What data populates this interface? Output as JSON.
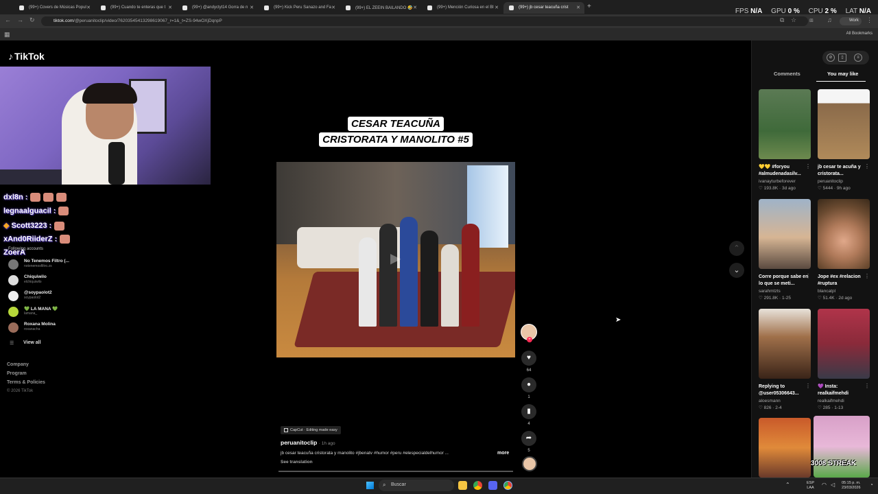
{
  "browser": {
    "tabs": [
      {
        "label": "(99+) Covers de Músicas Popul"
      },
      {
        "label": "(99+) Cuando te enteras que t"
      },
      {
        "label": "(99+) @andyctyt14 Gorra de n"
      },
      {
        "label": "(99+) Kick Peru Sanazo and Fa"
      },
      {
        "label": "(99+) EL ZEEIN BAILANDO 🤣"
      },
      {
        "label": "(99+) Mención Curiosa en el Bl"
      },
      {
        "label": "(99+) jb cesar teacuña crist"
      }
    ],
    "new_tab": "+",
    "url_host": "tiktok.com",
    "url_path": "/@peruanitoclip/video/76203545413298619067_r=1&_t=ZS-94wOXjDqnpP",
    "profile_label": "Work",
    "all_bookmarks": "All Bookmarks"
  },
  "perf_overlay": {
    "fps_label": "FPS",
    "fps_value": "N/A",
    "gpu_label": "GPU",
    "gpu_value": "0 %",
    "cpu_label": "CPU",
    "cpu_value": "2 %",
    "lat_label": "LAT",
    "lat_value": "N/A"
  },
  "tiktok": {
    "logo": "TikTok",
    "chat": [
      {
        "user": "dxl8n :"
      },
      {
        "user": "legnaalguacil :"
      },
      {
        "user": "Scott3223 :"
      },
      {
        "user": "xAnd0RiiderZ :"
      },
      {
        "user": "ZoerA"
      }
    ],
    "following_title": "Following accounts",
    "following": [
      {
        "name": "No Tenemos Filtro (...",
        "handle": "notenemosfiltro.zs"
      },
      {
        "name": "Chiquiwilo",
        "handle": "elchiquiwilo"
      },
      {
        "name": "@soypaolot2",
        "handle": "soypaolot2"
      },
      {
        "name": "💚 LA MANA 💚",
        "handle": "lamana_"
      },
      {
        "name": "Roxana Molina",
        "handle": "roxanacha"
      }
    ],
    "view_all": "View all",
    "footer": {
      "company": "Company",
      "program": "Program",
      "terms": "Terms & Policies",
      "copyright": "© 2026 TikTok"
    }
  },
  "video": {
    "title_line1": "CESAR TEACUÑA",
    "title_line2": "CRISTORATA Y MANOLITO #5",
    "capcut_label": "CapCut · Editing made easy",
    "author": "peruanitoclip",
    "time_ago": "· 1h ago",
    "description": "jb cesar teacuña cristorata y manolito #jbenatv #humor #peru #elespecialdelhumor ...",
    "more": "more",
    "see_translation": "See translation",
    "likes": "64",
    "comments": "1",
    "saves": "4",
    "shares": "5"
  },
  "right_panel": {
    "tab_comments": "Comments",
    "tab_you_may_like": "You may like",
    "cards": [
      {
        "caption": "💛💛 #foryou #almudenadasilv...",
        "user": "ivanayturbeforever",
        "stats": "♡ 193.8K · 3d ago"
      },
      {
        "caption": "jb cesar te acuña y cristorata...",
        "user": "peruanitoclip",
        "stats": "♡ 5444 · 9h ago"
      },
      {
        "caption": "Corre porque sabe en lo que se meti...",
        "user": "sarahmtzts",
        "stats": "♡ 291.8K · 1-25"
      },
      {
        "caption": "Jope #ex #relacion #ruptura",
        "user": "blancatpl",
        "stats": "♡ 51.4K · 2d ago"
      },
      {
        "caption": "Replying to @user05306643...",
        "user": "aloesmann",
        "stats": "♡ 826 · 2-4"
      },
      {
        "caption": "💜 Insta: realkaifmehdi",
        "user": "realkaifmehdi",
        "stats": "♡ 285 · 1-13"
      }
    ],
    "streak_overlay": "3008 STREAK"
  },
  "taskbar": {
    "search_placeholder": "Buscar",
    "lang_top": "ESP",
    "lang_bottom": "LAA",
    "time": "05:15 p. m.",
    "date": "23/03/2026"
  },
  "colors": {
    "tiktok_red": "#fe2c55",
    "page_bg": "#000000",
    "panel_bg": "#121212"
  }
}
